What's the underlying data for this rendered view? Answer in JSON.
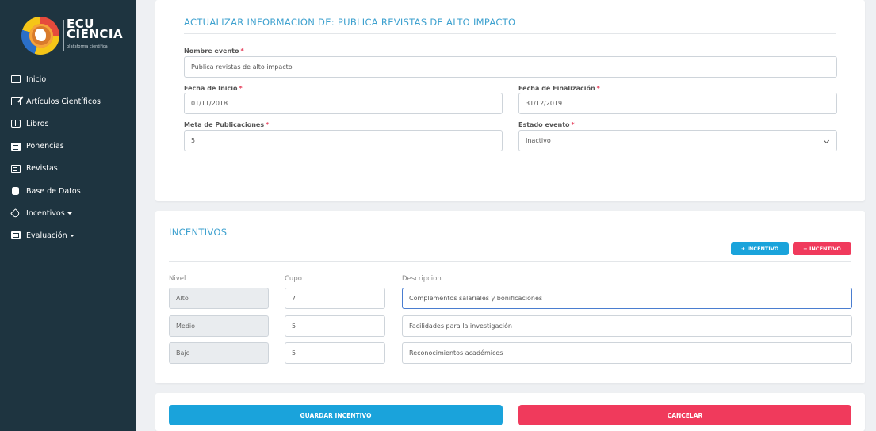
{
  "brand": {
    "line1": "ECU",
    "line2": "CIENCIA",
    "tagline": "plataforma científica"
  },
  "sidebar": {
    "items": [
      {
        "label": "Inicio",
        "icon": "square-icon"
      },
      {
        "label": "Artículos Científicos",
        "icon": "edit-icon"
      },
      {
        "label": "Libros",
        "icon": "book-icon"
      },
      {
        "label": "Ponencias",
        "icon": "calendar-icon"
      },
      {
        "label": "Revistas",
        "icon": "document-icon"
      },
      {
        "label": "Base de Datos",
        "icon": "database-icon"
      },
      {
        "label": "Incentivos",
        "icon": "tag-icon",
        "dropdown": true
      },
      {
        "label": "Evaluación",
        "icon": "table-icon",
        "dropdown": true
      }
    ]
  },
  "event_form": {
    "title": "ACTUALIZAR INFORMACIÓN DE: PUBLICA REVISTAS DE ALTO IMPACTO",
    "required_mark": "*",
    "nombre_label": "Nombre evento",
    "nombre_value": "Publica revistas de alto impacto",
    "fecha_inicio_label": "Fecha de Inicio",
    "fecha_inicio_value": "01/11/2018",
    "fecha_fin_label": "Fecha de Finalización",
    "fecha_fin_value": "31/12/2019",
    "meta_label": "Meta de Publicaciones",
    "meta_value": "5",
    "estado_label": "Estado evento",
    "estado_value": "Inactivo"
  },
  "incentivos": {
    "title": "INCENTIVOS",
    "add_label": "+ INCENTIVO",
    "remove_label": "− INCENTIVO",
    "columns": {
      "nivel": "Nivel",
      "cupo": "Cupo",
      "descripcion": "Descripcion"
    },
    "rows": [
      {
        "nivel": "Alto",
        "cupo": "7",
        "descripcion": "Complementos salariales y bonificaciones"
      },
      {
        "nivel": "Medio",
        "cupo": "5",
        "descripcion": "Facilidades para la investigación"
      },
      {
        "nivel": "Bajo",
        "cupo": "5",
        "descripcion": "Reconocimientos académicos"
      }
    ]
  },
  "actions": {
    "save_label": "GUARDAR INCENTIVO",
    "cancel_label": "CANCELAR"
  },
  "colors": {
    "sidebar_bg": "#1e3440",
    "accent_blue": "#1aa3db",
    "accent_red": "#f03a5c",
    "title_blue": "#3ea1cf"
  }
}
